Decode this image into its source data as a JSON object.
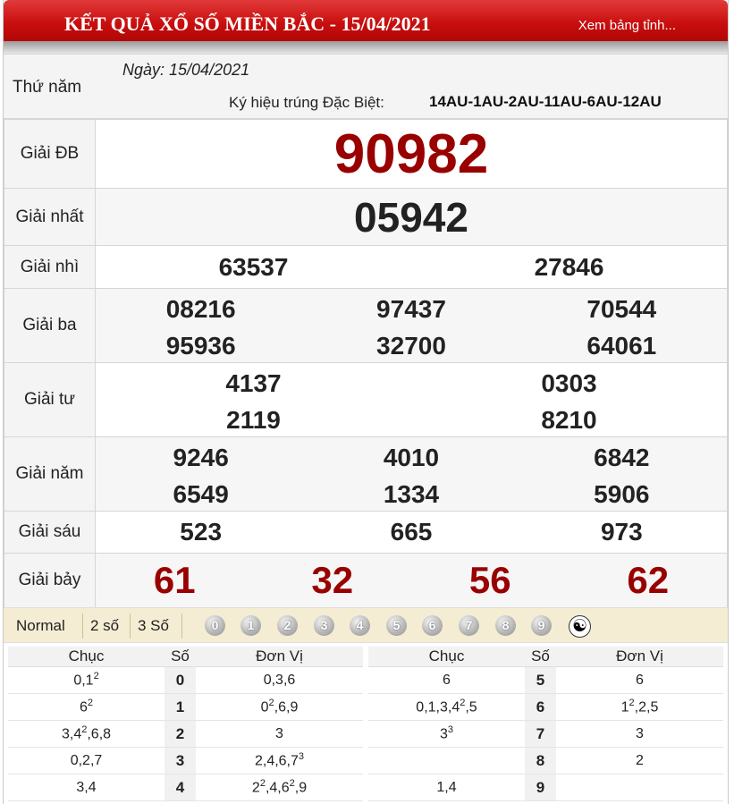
{
  "header": {
    "title": "KẾT QUẢ XỔ SỐ MIỀN BẮC - 15/04/2021",
    "link": "Xem bảng tỉnh...",
    "color": "#c80e0e"
  },
  "info": {
    "weekday": "Thứ năm",
    "date": "Ngày: 15/04/2021",
    "codes_label": "Ký hiệu trúng Đặc Biệt:",
    "codes": "14AU-1AU-2AU-11AU-6AU-12AU"
  },
  "prizes": {
    "db": {
      "label": "Giải ĐB",
      "numbers": [
        "90982"
      ]
    },
    "nhat": {
      "label": "Giải nhất",
      "numbers": [
        "05942"
      ]
    },
    "nhi": {
      "label": "Giải nhì",
      "numbers": [
        "63537",
        "27846"
      ]
    },
    "ba": {
      "label": "Giải ba",
      "numbers": [
        "08216",
        "97437",
        "70544",
        "95936",
        "32700",
        "64061"
      ]
    },
    "tu": {
      "label": "Giải tư",
      "numbers": [
        "4137",
        "0303",
        "2119",
        "8210"
      ]
    },
    "nam": {
      "label": "Giải năm",
      "numbers": [
        "9246",
        "4010",
        "6842",
        "6549",
        "1334",
        "5906"
      ]
    },
    "sau": {
      "label": "Giải sáu",
      "numbers": [
        "523",
        "665",
        "973"
      ]
    },
    "bay": {
      "label": "Giải bảy",
      "numbers": [
        "61",
        "32",
        "56",
        "62"
      ]
    }
  },
  "filters": {
    "buttons": [
      "Normal",
      "2 số",
      "3 Số"
    ],
    "digits": [
      "0",
      "1",
      "2",
      "3",
      "4",
      "5",
      "6",
      "7",
      "8",
      "9"
    ]
  },
  "loto": {
    "headers": {
      "chuc": "Chục",
      "so": "Số",
      "donvi": "Đơn Vị"
    },
    "left": [
      {
        "chuc": "0,1<sup>2</sup>",
        "so": "0",
        "donvi": "0,3,6"
      },
      {
        "chuc": "6<sup>2</sup>",
        "so": "1",
        "donvi": "0<sup>2</sup>,6,9"
      },
      {
        "chuc": "3,4<sup>2</sup>,6,8",
        "so": "2",
        "donvi": "3"
      },
      {
        "chuc": "0,2,7",
        "so": "3",
        "donvi": "2,4,6,7<sup>3</sup>"
      },
      {
        "chuc": "3,4",
        "so": "4",
        "donvi": "2<sup>2</sup>,4,6<sup>2</sup>,9"
      }
    ],
    "right": [
      {
        "chuc": "6",
        "so": "5",
        "donvi": "6"
      },
      {
        "chuc": "0,1,3,4<sup>2</sup>,5",
        "so": "6",
        "donvi": "1<sup>2</sup>,2,5"
      },
      {
        "chuc": "3<sup>3</sup>",
        "so": "7",
        "donvi": "3"
      },
      {
        "chuc": "",
        "so": "8",
        "donvi": "2"
      },
      {
        "chuc": "1,4",
        "so": "9",
        "donvi": ""
      }
    ]
  }
}
